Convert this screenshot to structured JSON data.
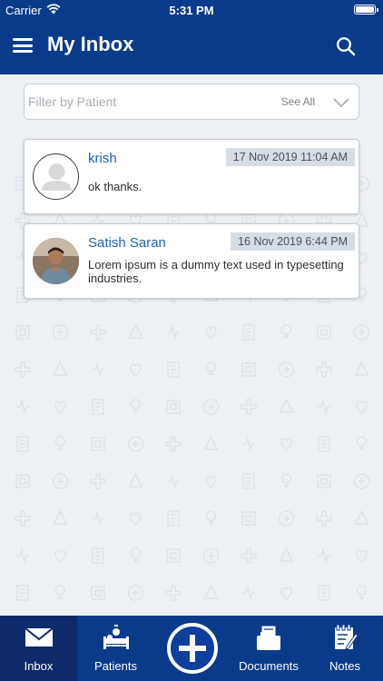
{
  "status_bar": {
    "carrier": "Carrier",
    "time": "5:31 PM"
  },
  "header": {
    "title": "My Inbox",
    "menu_icon": "hamburger-menu-icon",
    "search_icon": "search-icon"
  },
  "filter": {
    "placeholder": "Filter by Patient",
    "see_all_label": "See All"
  },
  "messages": [
    {
      "sender": "krish",
      "timestamp": "17 Nov 2019 11:04 AM",
      "text": "ok thanks.",
      "avatar": "default-avatar-icon"
    },
    {
      "sender": "Satish Saran",
      "timestamp": "16 Nov 2019 6:44 PM",
      "text": "Lorem ipsum is a dummy text used in typesetting industries.",
      "avatar": "user-photo"
    }
  ],
  "tabs": [
    {
      "label": "Inbox",
      "icon": "envelope-icon",
      "active": true
    },
    {
      "label": "Patients",
      "icon": "patient-bed-icon"
    },
    {
      "label": "",
      "icon": "add-circle-icon"
    },
    {
      "label": "Documents",
      "icon": "documents-icon"
    },
    {
      "label": "Notes",
      "icon": "notes-icon"
    }
  ],
  "colors": {
    "primary": "#0a3a8a",
    "active_tab": "#0e2a6a",
    "name_link": "#1a66b5",
    "timestamp_bg": "#d7dde6",
    "background": "#eef1f4"
  }
}
